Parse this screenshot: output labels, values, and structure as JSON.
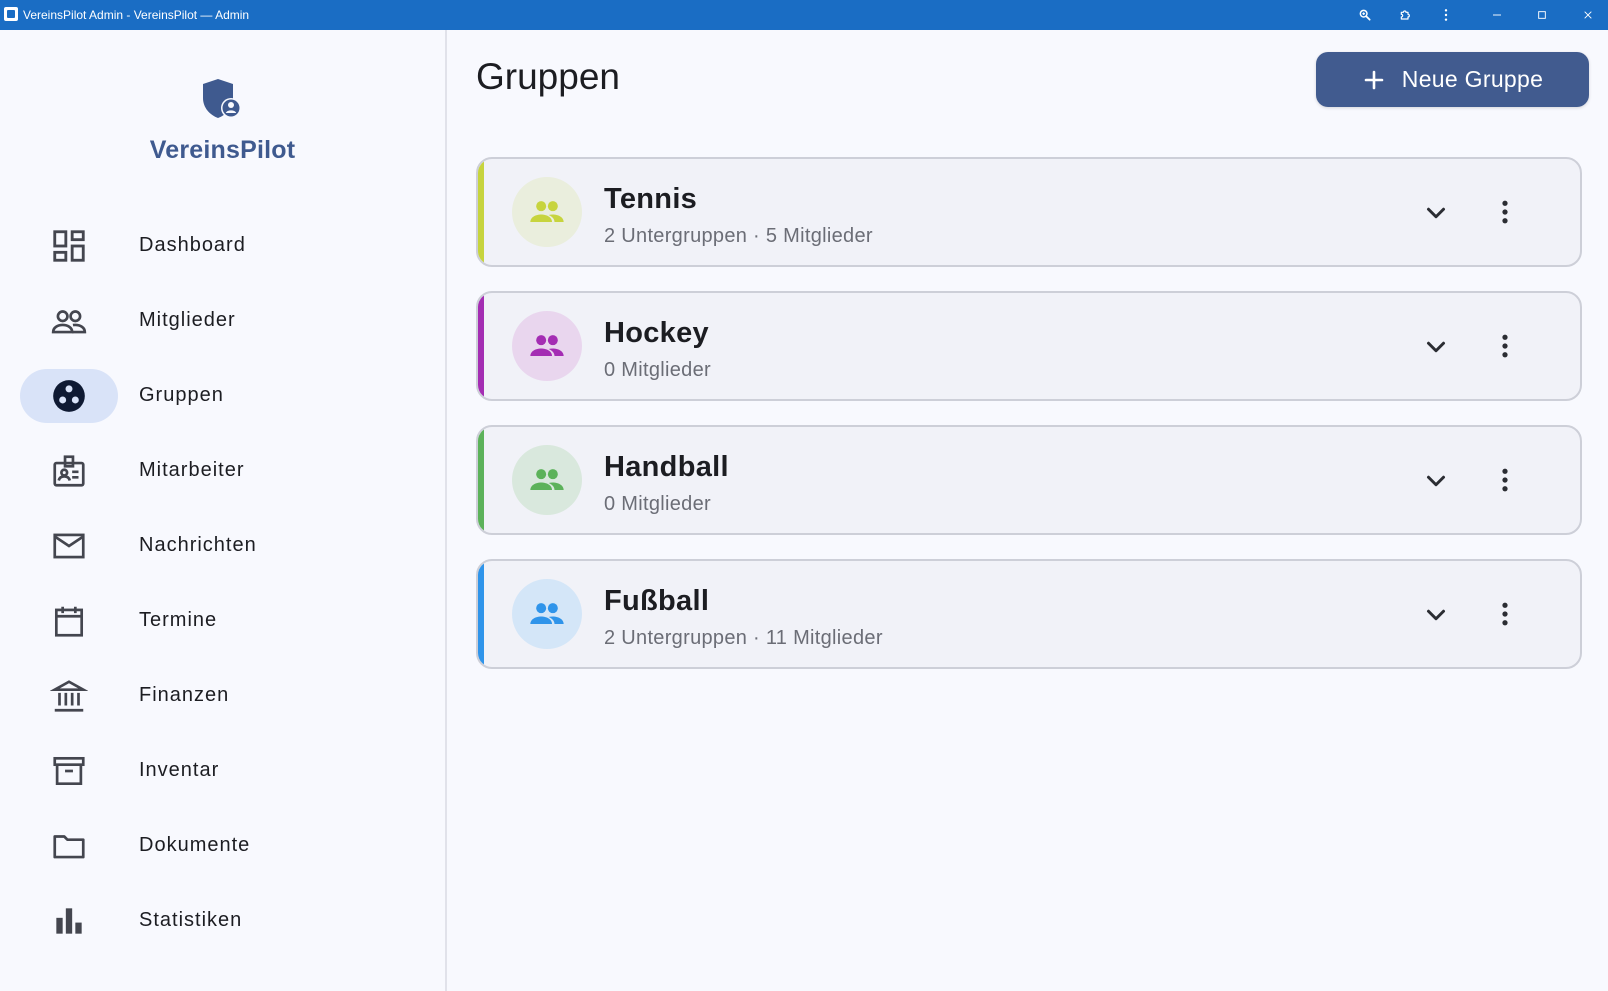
{
  "window": {
    "title": "VereinsPilot Admin - VereinsPilot — Admin",
    "accent": "#1a6dc4"
  },
  "sidebar": {
    "brand": "VereinsPilot",
    "brand_color": "#3f5a8f",
    "items": [
      {
        "label": "Dashboard",
        "icon": "dashboard-icon",
        "active": false
      },
      {
        "label": "Mitglieder",
        "icon": "people-icon",
        "active": false
      },
      {
        "label": "Gruppen",
        "icon": "groups-icon",
        "active": true
      },
      {
        "label": "Mitarbeiter",
        "icon": "badge-icon",
        "active": false
      },
      {
        "label": "Nachrichten",
        "icon": "mail-icon",
        "active": false
      },
      {
        "label": "Termine",
        "icon": "calendar-icon",
        "active": false
      },
      {
        "label": "Finanzen",
        "icon": "bank-icon",
        "active": false
      },
      {
        "label": "Inventar",
        "icon": "archive-icon",
        "active": false
      },
      {
        "label": "Dokumente",
        "icon": "folder-icon",
        "active": false
      },
      {
        "label": "Statistiken",
        "icon": "bar-chart-icon",
        "active": false
      }
    ]
  },
  "main": {
    "title": "Gruppen",
    "new_button_label": "Neue Gruppe",
    "groups": [
      {
        "name": "Tennis",
        "meta": "2 Untergruppen · 5 Mitglieder",
        "color": "#c7d43e",
        "avatar_bg": "#eaeedd"
      },
      {
        "name": "Hockey",
        "meta": "0 Mitglieder",
        "color": "#a42db3",
        "avatar_bg": "#e9d6ee"
      },
      {
        "name": "Handball",
        "meta": "0 Mitglieder",
        "color": "#5cb25a",
        "avatar_bg": "#d9e8dd"
      },
      {
        "name": "Fußball",
        "meta": "2 Untergruppen · 11 Mitglieder",
        "color": "#2f94ea",
        "avatar_bg": "#d4e6f8"
      }
    ]
  }
}
